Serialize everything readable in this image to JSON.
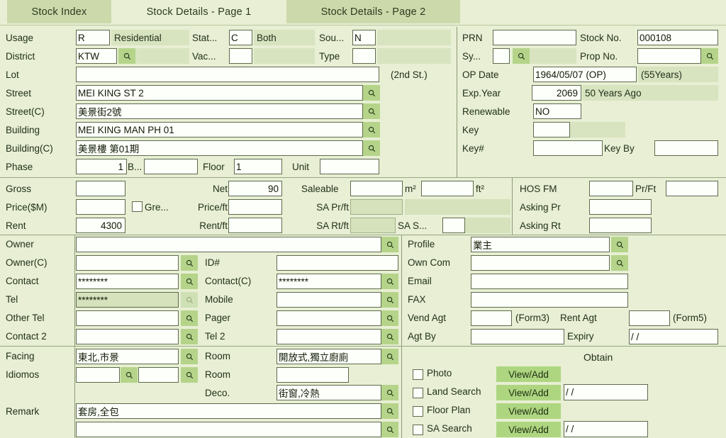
{
  "tabs": [
    {
      "label": "Stock Index",
      "active": false
    },
    {
      "label": "Stock Details - Page 1",
      "active": true
    },
    {
      "label": "Stock Details - Page 2",
      "active": false
    }
  ],
  "left_top": {
    "usage_label": "Usage",
    "usage_code": "R",
    "usage_text": "Residential",
    "status_label": "Stat...",
    "status_code": "C",
    "status_text": "Both",
    "source_label": "Sou...",
    "source_code": "N",
    "district_label": "District",
    "district_code": "KTW",
    "vacant_label": "Vac...",
    "vacant_code": "",
    "type_label": "Type",
    "type_code": "",
    "lot_label": "Lot",
    "lot_value": "",
    "second_st": "(2nd St.)",
    "street_label": "Street",
    "street_value": "MEI KING ST 2",
    "street_c_label": "Street(C)",
    "street_c_value": "美景街2號",
    "building_label": "Building",
    "building_value": "MEI KING MAN PH 01",
    "building_c_label": "Building(C)",
    "building_c_value": "美景樓 第01期",
    "phase_label": "Phase",
    "phase_value": "1",
    "block_label": "B...",
    "block_value": "",
    "floor_label": "Floor",
    "floor_value": "1",
    "unit_label": "Unit",
    "unit_value": ""
  },
  "right_top": {
    "prn_label": "PRN",
    "prn_value": "",
    "stock_no_label": "Stock No.",
    "stock_no_value": "000108",
    "sys_label": "Sy...",
    "sys_value": "",
    "prop_no_label": "Prop No.",
    "prop_no_value": "",
    "op_date_label": "OP Date",
    "op_date_value": "1964/05/07 (OP)",
    "op_age": "(55Years)",
    "exp_year_label": "Exp.Year",
    "exp_year_value": "2069",
    "exp_note": "50 Years Ago",
    "renewable_label": "Renewable",
    "renewable_value": "NO",
    "key_label": "Key",
    "key_value": "",
    "key_num_label": "Key#",
    "key_num_value": "",
    "key_by_label": "Key By",
    "key_by_value": ""
  },
  "area_price": {
    "gross_label": "Gross",
    "gross_value": "",
    "net_label": "Net",
    "net_value": "90",
    "saleable_label": "Saleable",
    "saleable_m2_value": "",
    "m2_label": "m²",
    "saleable_ft2_value": "",
    "ft2_label": "ft²",
    "hos_fm_label": "HOS FM",
    "hos_fm_value": "",
    "pr_ft_label": "Pr/Ft",
    "pr_ft_value": "",
    "price_label": "Price($M)",
    "price_value": "",
    "green_label": "Gre...",
    "green_checked": false,
    "price_ft_label": "Price/ft",
    "price_ft_value": "",
    "sa_pr_ft_label": "SA Pr/ft",
    "sa_pr_ft_value": "",
    "sa_pr_ft_extra": "",
    "asking_pr_label": "Asking Pr",
    "asking_pr_value": "",
    "rent_label": "Rent",
    "rent_value": "4300",
    "rent_ft_label": "Rent/ft",
    "rent_ft_value": "",
    "sa_rt_ft_label": "SA Rt/ft",
    "sa_rt_ft_value": "",
    "sa_s_label": "SA S...",
    "sa_s_value": "",
    "asking_rt_label": "Asking Rt",
    "asking_rt_value": ""
  },
  "contacts": {
    "owner_label": "Owner",
    "owner_value": "",
    "owner_c_label": "Owner(C)",
    "owner_c_value": "",
    "id_label": "ID#",
    "id_value": "",
    "contact_label": "Contact",
    "contact_value": "********",
    "contact_c_label": "Contact(C)",
    "contact_c_value": "********",
    "tel_label": "Tel",
    "tel_value": "********",
    "mobile_label": "Mobile",
    "mobile_value": "",
    "other_tel_label": "Other Tel",
    "other_tel_value": "",
    "pager_label": "Pager",
    "pager_value": "",
    "contact2_label": "Contact 2",
    "contact2_value": "",
    "tel2_label": "Tel 2",
    "tel2_value": ""
  },
  "agency": {
    "profile_label": "Profile",
    "profile_value": "業主",
    "own_com_label": "Own Com",
    "own_com_value": "",
    "email_label": "Email",
    "email_value": "",
    "fax_label": "FAX",
    "fax_value": "",
    "vend_agt_label": "Vend Agt",
    "vend_agt_value": "",
    "form3_label": "(Form3)",
    "rent_agt_label": "Rent Agt",
    "rent_agt_value": "",
    "form5_label": "(Form5)",
    "agt_by_label": "Agt By",
    "agt_by_value": "",
    "expiry_label": "Expiry",
    "expiry_value": "/ /"
  },
  "features": {
    "facing_label": "Facing",
    "facing_value": "東北,市景",
    "room_label": "Room",
    "room_value": "開放式,獨立廚廁",
    "idiomos_label": "Idiomos",
    "idiomos_value1": "",
    "idiomos_value2": "",
    "room2_label": "Room",
    "room2_value": "",
    "deco_label": "Deco.",
    "deco_value": "街窗,冷熱",
    "remark_label": "Remark",
    "remark_value": "套房,全包",
    "remark2_value": ""
  },
  "obtain": {
    "title": "Obtain",
    "rows": [
      {
        "label": "Photo",
        "checked": false,
        "button": "View/Add",
        "date": null
      },
      {
        "label": "Land Search",
        "checked": false,
        "button": "View/Add",
        "date": "/ /"
      },
      {
        "label": "Floor Plan",
        "checked": false,
        "button": "View/Add",
        "date": null
      },
      {
        "label": "SA Search",
        "checked": false,
        "button": "View/Add",
        "date": "/ /"
      }
    ]
  },
  "icons": {
    "search": "magnifier-icon"
  },
  "colors": {
    "page_bg": "#e8efd4",
    "tab_inactive": "#ccd9ab",
    "input_bg": "#fdfffa",
    "readonly_bg": "#d5e2bc",
    "lookup_btn": "#b5d48a",
    "action_btn": "#aed680",
    "border": "#5d6b4c"
  }
}
